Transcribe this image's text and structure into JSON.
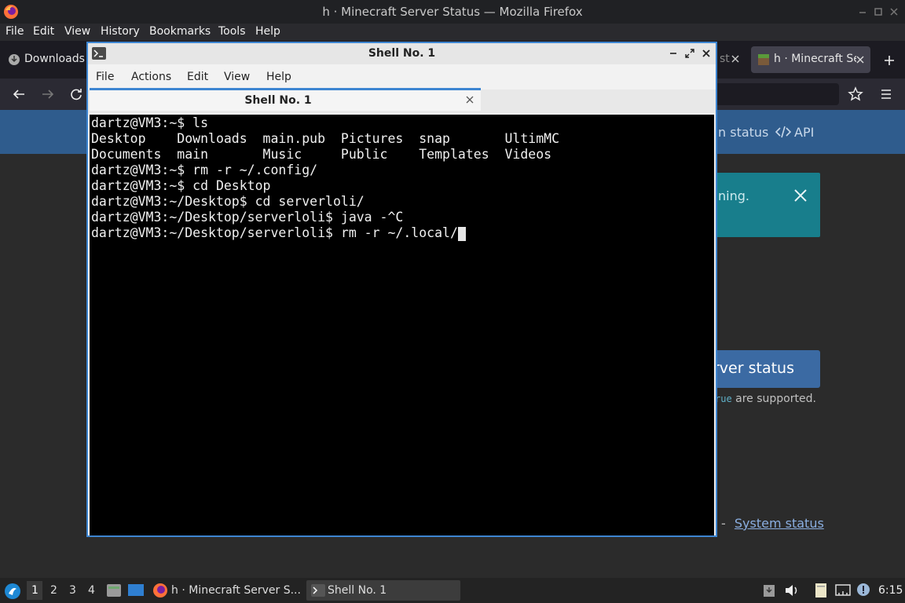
{
  "firefox": {
    "window_title": "h · Minecraft Server Status — Mozilla Firefox",
    "menu": [
      "File",
      "Edit",
      "View",
      "History",
      "Bookmarks",
      "Tools",
      "Help"
    ],
    "tab_downloads": "Downloads",
    "tab_partial": "st",
    "tab_active": "h · Minecraft Se",
    "header_links": {
      "status_partial": "n status",
      "api": "API"
    },
    "alert_text_partial": "ning.",
    "check_button_partial": "rver status",
    "supported_code": "rue",
    "supported_text": "are supported.",
    "footer_sep": "-",
    "footer_link": "System status"
  },
  "terminal": {
    "window_title": "Shell No. 1",
    "menu": [
      "File",
      "Actions",
      "Edit",
      "View",
      "Help"
    ],
    "tab_label": "Shell No. 1",
    "lines": [
      "dartz@VM3:~$ ls",
      "Desktop    Downloads  main.pub  Pictures  snap       UltimMC",
      "Documents  main       Music     Public    Templates  Videos",
      "dartz@VM3:~$ rm -r ~/.config/",
      "dartz@VM3:~$ cd Desktop",
      "dartz@VM3:~/Desktop$ cd serverloli/",
      "dartz@VM3:~/Desktop/serverloli$ java -^C",
      "dartz@VM3:~/Desktop/serverloli$ rm -r ~/.local/"
    ]
  },
  "taskbar": {
    "workspaces": [
      "1",
      "2",
      "3",
      "4"
    ],
    "active_workspace": "1",
    "tasks": [
      "h · Minecraft Server S...",
      "Shell No. 1"
    ],
    "clock": "6:15"
  },
  "colors": {
    "accent": "#3d85d1",
    "web_header": "#2f5c8d",
    "alert": "#187e8c",
    "terminal_bg": "#000000"
  }
}
